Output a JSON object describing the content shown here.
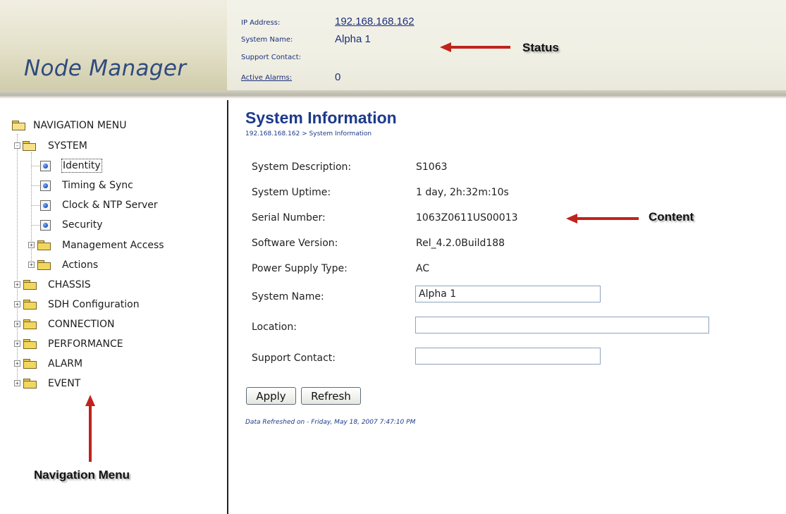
{
  "header": {
    "logo": "Node Manager",
    "status": {
      "ip_label": "IP Address:",
      "ip_value": "192.168.168.162",
      "name_label": "System Name:",
      "name_value": "Alpha 1",
      "contact_label": "Support Contact:",
      "contact_value": "",
      "alarms_label": "Active Alarms:",
      "alarms_value": "0"
    }
  },
  "annotations": {
    "status": "Status",
    "content": "Content",
    "navigation": "Navigation Menu",
    "arrow_color": "#c0221c"
  },
  "sidebar": {
    "root": "NAVIGATION MENU",
    "items": [
      {
        "label": "SYSTEM",
        "icon": "folder-open-icon",
        "expander": "-"
      },
      {
        "label": "Identity",
        "icon": "page-icon"
      },
      {
        "label": "Timing & Sync",
        "icon": "page-icon"
      },
      {
        "label": "Clock & NTP Server",
        "icon": "page-icon"
      },
      {
        "label": "Security",
        "icon": "page-icon"
      },
      {
        "label": "Management Access",
        "icon": "folder-icon",
        "expander": "+"
      },
      {
        "label": "Actions",
        "icon": "folder-icon",
        "expander": "+"
      },
      {
        "label": "CHASSIS",
        "icon": "folder-icon",
        "expander": "+"
      },
      {
        "label": "SDH Configuration",
        "icon": "folder-icon",
        "expander": "+"
      },
      {
        "label": "CONNECTION",
        "icon": "folder-icon",
        "expander": "+"
      },
      {
        "label": "PERFORMANCE",
        "icon": "folder-icon",
        "expander": "+"
      },
      {
        "label": "ALARM",
        "icon": "folder-icon",
        "expander": "+"
      },
      {
        "label": "EVENT",
        "icon": "folder-icon",
        "expander": "+"
      }
    ]
  },
  "main": {
    "title": "System Information",
    "breadcrumb": "192.168.168.162 > System Information",
    "fields": {
      "description_label": "System Description:",
      "description_value": "S1063",
      "uptime_label": "System Uptime:",
      "uptime_value": "1 day, 2h:32m:10s",
      "serial_label": "Serial Number:",
      "serial_value": "1063Z0611US00013",
      "software_label": "Software Version:",
      "software_value": "Rel_4.2.0Build188",
      "power_label": "Power Supply Type:",
      "power_value": "AC",
      "name_label": "System Name:",
      "name_value": "Alpha 1",
      "location_label": "Location:",
      "location_value": "",
      "contact_label": "Support Contact:",
      "contact_value": ""
    },
    "apply_label": "Apply",
    "refresh_label": "Refresh",
    "refreshed_text": "Data Refreshed on - Friday, May 18, 2007 7:47:10 PM"
  }
}
